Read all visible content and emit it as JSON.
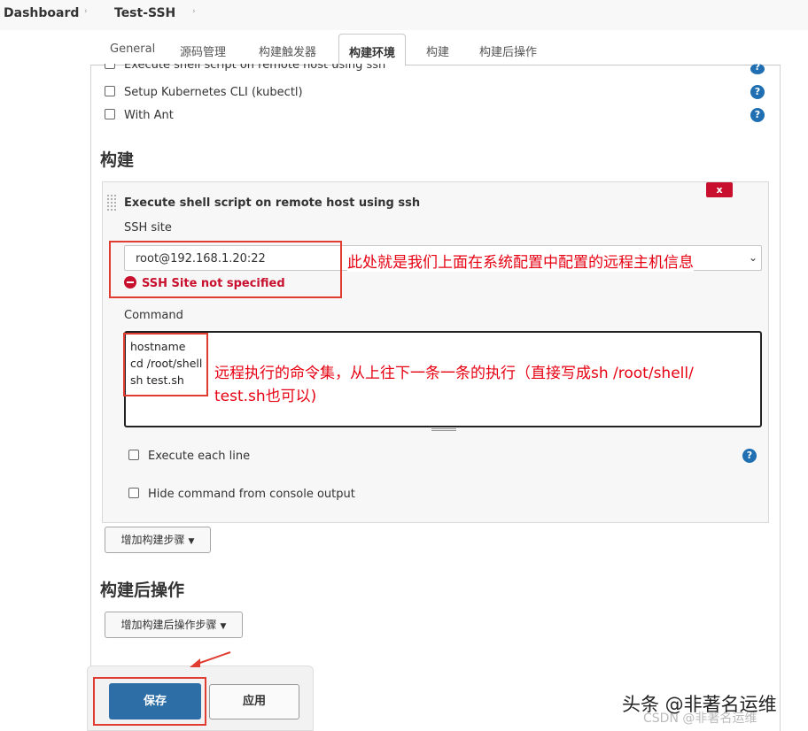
{
  "breadcrumb": {
    "items": [
      "Dashboard",
      "Test-SSH"
    ],
    "separator": "›"
  },
  "tabs": [
    {
      "label": "General"
    },
    {
      "label": "源码管理"
    },
    {
      "label": "构建触发器"
    },
    {
      "label": "构建环境",
      "active": true
    },
    {
      "label": "构建"
    },
    {
      "label": "构建后操作"
    }
  ],
  "build_env_options": [
    {
      "label": "Execute shell script on remote host using ssh",
      "checked": false
    },
    {
      "label": "Setup Kubernetes CLI (kubectl)",
      "checked": false
    },
    {
      "label": "With Ant",
      "checked": false
    }
  ],
  "help_glyph": "?",
  "build_section": {
    "title": "构建",
    "step": {
      "title": "Execute shell script on remote host using ssh",
      "close_label": "x",
      "ssh_site_label": "SSH site",
      "ssh_site_value": "root@192.168.1.20:22",
      "dropdown_caret": "⌄",
      "error_text": "SSH Site not specified",
      "command_label": "Command",
      "command_lines": [
        "hostname",
        "cd /root/shell",
        "sh test.sh"
      ],
      "execute_each_line_label": "Execute each line",
      "hide_command_label": "Hide command from console output"
    },
    "add_step_button": "增加构建步骤"
  },
  "post_build_section": {
    "title": "构建后操作",
    "add_step_button": "增加构建后操作步骤"
  },
  "annotations": {
    "ssh_site_note": "此处就是我们上面在系统配置中配置的远程主机信息",
    "command_note_line1": "远程执行的命令集，从上往下一条一条的执行（直接写成sh /root/shell/",
    "command_note_line2": "test.sh也可以)"
  },
  "actions": {
    "save_label": "保存",
    "apply_label": "应用"
  },
  "watermark": {
    "text": "头条 @非著名运维",
    "subtext": "CSDN @非著名运维"
  },
  "colors": {
    "primary_button": "#2d6ea6",
    "error": "#c8102e",
    "annotation": "#e60012",
    "help_icon": "#1f6fb2"
  }
}
